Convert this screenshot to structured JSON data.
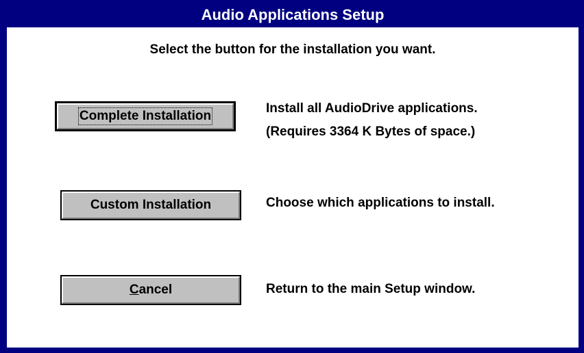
{
  "window": {
    "title": "Audio Applications Setup"
  },
  "dialog": {
    "instruction": "Select the button for the installation you want.",
    "options": [
      {
        "button_label": "Complete Installation",
        "description_lines": [
          "Install all AudioDrive applications.",
          "(Requires 3364 K Bytes of space.)"
        ]
      },
      {
        "button_label": "Custom Installation",
        "description_lines": [
          "Choose which applications to install."
        ]
      },
      {
        "button_label_mnemonic": "C",
        "button_label_rest": "ancel",
        "description_lines": [
          "Return to the main Setup window."
        ]
      }
    ]
  },
  "colors": {
    "titlebar": "#000080",
    "button_face": "#c0c0c0",
    "background": "#ffffff"
  }
}
